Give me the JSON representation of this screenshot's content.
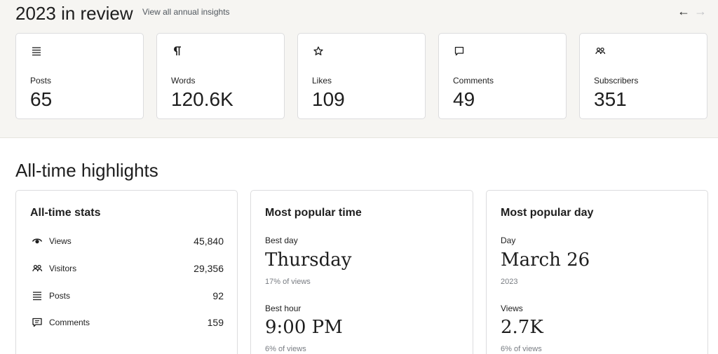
{
  "review": {
    "title": "2023 in review",
    "link": "View all annual insights",
    "prev_arrow": "←",
    "next_arrow": "→",
    "cards": [
      {
        "icon": "posts-icon",
        "label": "Posts",
        "value": "65"
      },
      {
        "icon": "pilcrow-icon",
        "label": "Words",
        "value": "120.6K"
      },
      {
        "icon": "star-icon",
        "label": "Likes",
        "value": "109"
      },
      {
        "icon": "comment-icon",
        "label": "Comments",
        "value": "49"
      },
      {
        "icon": "people-icon",
        "label": "Subscribers",
        "value": "351"
      }
    ]
  },
  "highlights": {
    "title": "All-time highlights",
    "stats": {
      "title": "All-time stats",
      "rows": [
        {
          "icon": "eye-icon",
          "label": "Views",
          "value": "45,840"
        },
        {
          "icon": "people-icon",
          "label": "Visitors",
          "value": "29,356"
        },
        {
          "icon": "posts-icon",
          "label": "Posts",
          "value": "92"
        },
        {
          "icon": "comment-icon",
          "label": "Comments",
          "value": "159"
        }
      ]
    },
    "popular_time": {
      "title": "Most popular time",
      "best_day_label": "Best day",
      "best_day": "Thursday",
      "best_day_share": "17% of views",
      "best_hour_label": "Best hour",
      "best_hour": "9:00 PM",
      "best_hour_share": "6% of views"
    },
    "popular_day": {
      "title": "Most popular day",
      "day_label": "Day",
      "day": "March 26",
      "year": "2023",
      "views_label": "Views",
      "views": "2.7K",
      "views_share": "6% of views"
    }
  }
}
